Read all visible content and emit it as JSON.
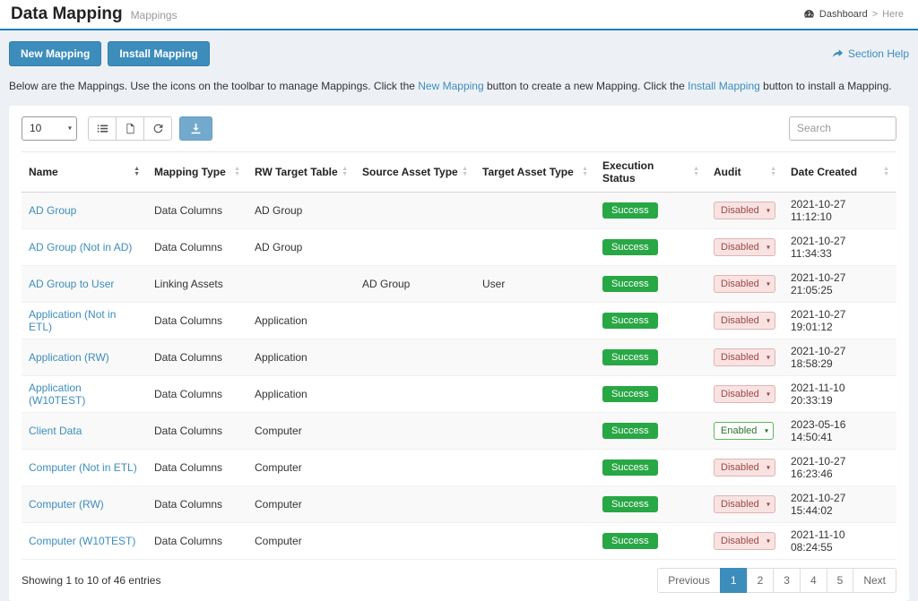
{
  "header": {
    "title": "Data Mapping",
    "subtitle": "Mappings",
    "breadcrumb": {
      "dashboard": "Dashboard",
      "separator": ">",
      "current": "Here"
    }
  },
  "actions": {
    "new_mapping": "New Mapping",
    "install_mapping": "Install Mapping",
    "section_help": "Section Help"
  },
  "description": {
    "part1": "Below are the Mappings. Use the icons on the toolbar to manage Mappings. Click the ",
    "link1": "New Mapping",
    "part2": " button to create a new Mapping. Click the ",
    "link2": "Install Mapping",
    "part3": " button to install a Mapping."
  },
  "controls": {
    "page_size": "10",
    "search_placeholder": "Search"
  },
  "icons": {
    "breadcrumb": "dashboard-icon",
    "help": "arrow-forward-icon",
    "toolbar": [
      "list-icon",
      "file-export-icon",
      "refresh-icon",
      "download-icon"
    ],
    "select_caret": "chevron-down-icon",
    "sort": "sort-arrows-icon"
  },
  "colors": {
    "primary": "#3c8dbc",
    "header_underline": "#1d80c3",
    "success": "#28a745",
    "audit_disabled_bg": "#f9e2e2",
    "audit_disabled_text": "#9c4a48",
    "audit_enabled_border": "#5cb85c"
  },
  "table": {
    "headers": [
      {
        "label": "Name",
        "sorted": true
      },
      {
        "label": "Mapping Type",
        "sorted": false
      },
      {
        "label": "RW Target Table",
        "sorted": false
      },
      {
        "label": "Source Asset Type",
        "sorted": false
      },
      {
        "label": "Target Asset Type",
        "sorted": false
      },
      {
        "label": "Execution Status",
        "sorted": false
      },
      {
        "label": "Audit",
        "sorted": false
      },
      {
        "label": "Date Created",
        "sorted": false
      }
    ],
    "rows": [
      {
        "name": "AD Group",
        "mapping_type": "Data Columns",
        "rw_target_table": "AD Group",
        "source_asset_type": "",
        "target_asset_type": "",
        "execution_status": "Success",
        "audit": "Disabled",
        "date_created": "2021-10-27 11:12:10"
      },
      {
        "name": "AD Group (Not in AD)",
        "mapping_type": "Data Columns",
        "rw_target_table": "AD Group",
        "source_asset_type": "",
        "target_asset_type": "",
        "execution_status": "Success",
        "audit": "Disabled",
        "date_created": "2021-10-27 11:34:33"
      },
      {
        "name": "AD Group to User",
        "mapping_type": "Linking Assets",
        "rw_target_table": "",
        "source_asset_type": "AD Group",
        "target_asset_type": "User",
        "execution_status": "Success",
        "audit": "Disabled",
        "date_created": "2021-10-27 21:05:25"
      },
      {
        "name": "Application (Not in ETL)",
        "mapping_type": "Data Columns",
        "rw_target_table": "Application",
        "source_asset_type": "",
        "target_asset_type": "",
        "execution_status": "Success",
        "audit": "Disabled",
        "date_created": "2021-10-27 19:01:12"
      },
      {
        "name": "Application (RW)",
        "mapping_type": "Data Columns",
        "rw_target_table": "Application",
        "source_asset_type": "",
        "target_asset_type": "",
        "execution_status": "Success",
        "audit": "Disabled",
        "date_created": "2021-10-27 18:58:29"
      },
      {
        "name": "Application (W10TEST)",
        "mapping_type": "Data Columns",
        "rw_target_table": "Application",
        "source_asset_type": "",
        "target_asset_type": "",
        "execution_status": "Success",
        "audit": "Disabled",
        "date_created": "2021-11-10 20:33:19"
      },
      {
        "name": "Client Data",
        "mapping_type": "Data Columns",
        "rw_target_table": "Computer",
        "source_asset_type": "",
        "target_asset_type": "",
        "execution_status": "Success",
        "audit": "Enabled",
        "date_created": "2023-05-16 14:50:41"
      },
      {
        "name": "Computer (Not in ETL)",
        "mapping_type": "Data Columns",
        "rw_target_table": "Computer",
        "source_asset_type": "",
        "target_asset_type": "",
        "execution_status": "Success",
        "audit": "Disabled",
        "date_created": "2021-10-27 16:23:46"
      },
      {
        "name": "Computer (RW)",
        "mapping_type": "Data Columns",
        "rw_target_table": "Computer",
        "source_asset_type": "",
        "target_asset_type": "",
        "execution_status": "Success",
        "audit": "Disabled",
        "date_created": "2021-10-27 15:44:02"
      },
      {
        "name": "Computer (W10TEST)",
        "mapping_type": "Data Columns",
        "rw_target_table": "Computer",
        "source_asset_type": "",
        "target_asset_type": "",
        "execution_status": "Success",
        "audit": "Disabled",
        "date_created": "2021-11-10 08:24:55"
      }
    ]
  },
  "footer": {
    "showing": "Showing 1 to 10 of 46 entries",
    "pagination": [
      {
        "label": "Previous",
        "active": false
      },
      {
        "label": "1",
        "active": true
      },
      {
        "label": "2",
        "active": false
      },
      {
        "label": "3",
        "active": false
      },
      {
        "label": "4",
        "active": false
      },
      {
        "label": "5",
        "active": false
      },
      {
        "label": "Next",
        "active": false
      }
    ]
  }
}
